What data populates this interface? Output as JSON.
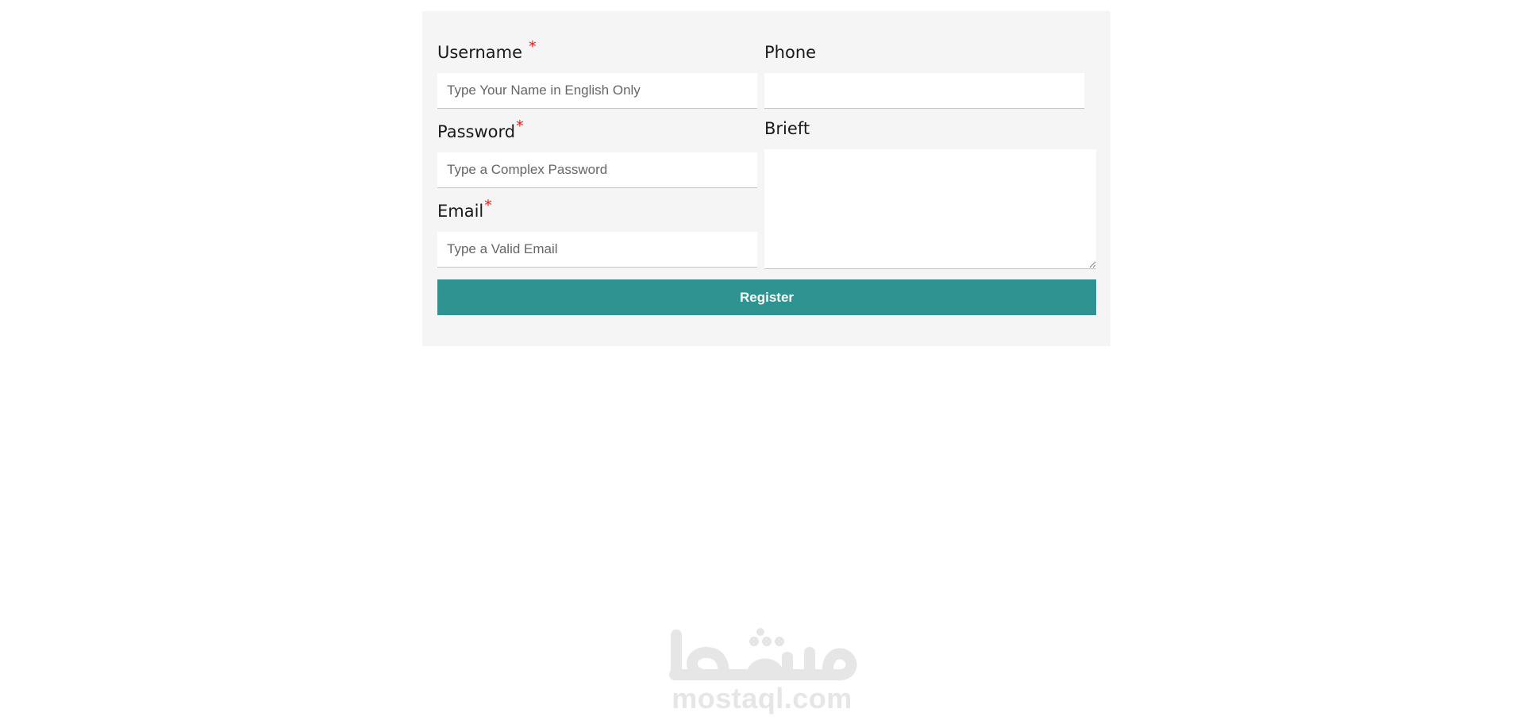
{
  "form": {
    "username": {
      "label": "Username",
      "required_mark": "*",
      "placeholder": "Type Your Name in English Only",
      "value": ""
    },
    "password": {
      "label": "Password",
      "required_mark": "*",
      "placeholder": "Type a Complex Password",
      "value": ""
    },
    "email": {
      "label": "Email",
      "required_mark": "*",
      "placeholder": "Type a Valid Email",
      "value": ""
    },
    "phone": {
      "label": "Phone",
      "placeholder": "",
      "value": ""
    },
    "brief": {
      "label": "Brieft",
      "value": ""
    },
    "register_label": "Register"
  },
  "watermark": {
    "arabic_text": "مستقل",
    "domain_text": "mostaql.com"
  },
  "colors": {
    "card_background": "#f5f5f5",
    "button_background": "#2e9391",
    "required_mark": "#e01b1b",
    "watermark": "#e6e6e6"
  }
}
